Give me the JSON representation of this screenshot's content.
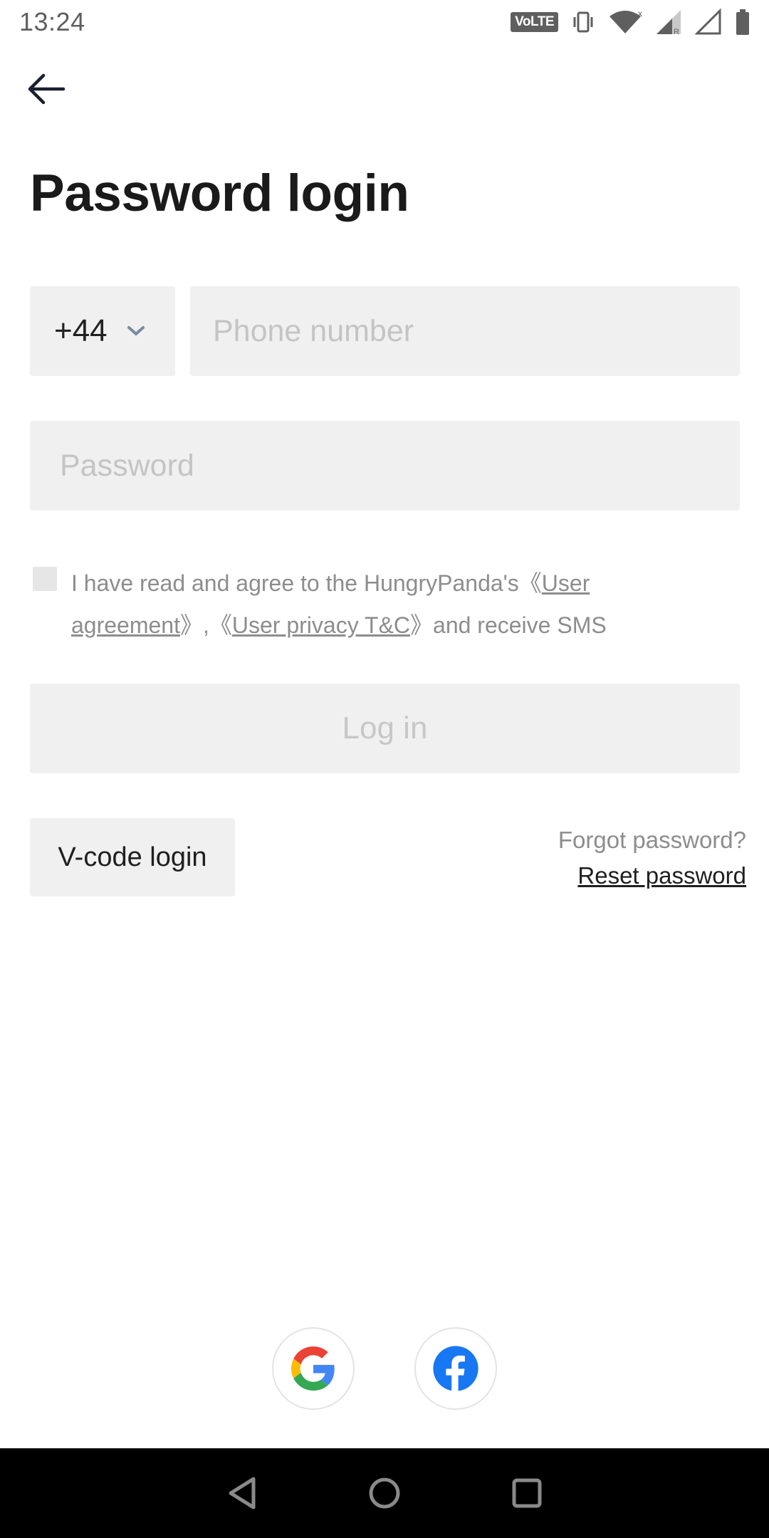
{
  "status_bar": {
    "time": "13:24",
    "volte": "VoLTE",
    "icons": [
      "volte-icon",
      "vibrate-icon",
      "wifi-icon",
      "signal-icon",
      "signal-empty-icon",
      "battery-icon"
    ]
  },
  "header": {
    "back_icon": "arrow-left-icon",
    "title": "Password login"
  },
  "form": {
    "country_code": "+44",
    "phone_placeholder": "Phone number",
    "password_placeholder": "Password"
  },
  "agreement": {
    "prefix": "I have read and agree to the HungryPanda's《",
    "link1": "User agreement",
    "middle": "》,《",
    "link2": "User privacy T&C",
    "suffix": "》and receive SMS"
  },
  "actions": {
    "login_label": "Log in",
    "vcode_label": "V-code login",
    "forgot_text": "Forgot password?",
    "reset_label": "Reset password"
  },
  "social": {
    "providers": [
      "google-icon",
      "facebook-icon"
    ]
  },
  "colors": {
    "primary_text": "#1a1a1a",
    "muted_text": "#8d8d8d",
    "field_bg": "#f0f0f0",
    "disabled_text": "#c7c7c7",
    "facebook_blue": "#1877F2"
  }
}
